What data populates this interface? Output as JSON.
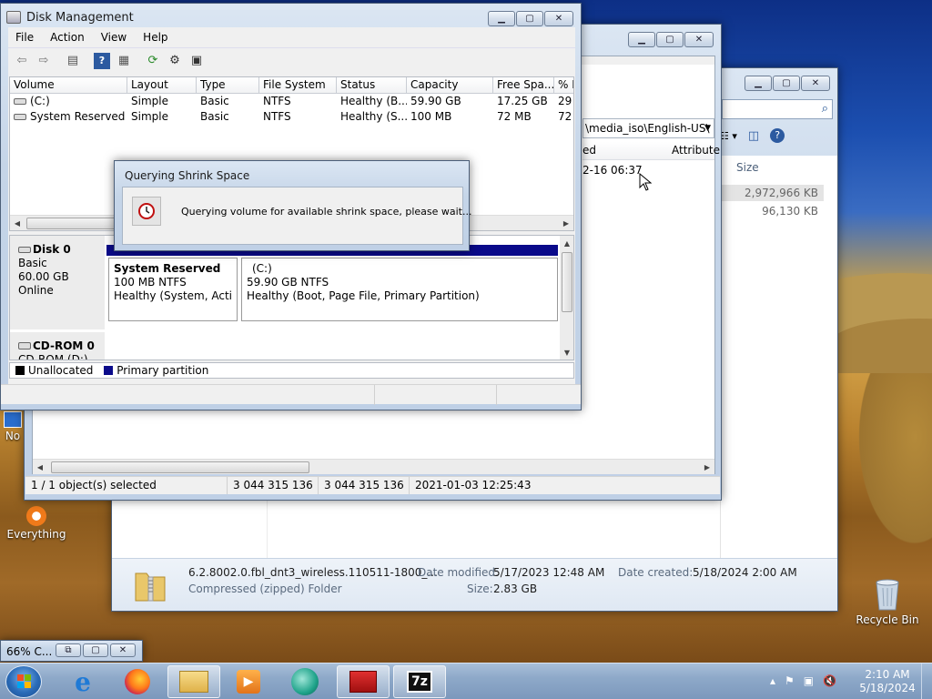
{
  "disk_management": {
    "title": "Disk Management",
    "menu": [
      "File",
      "Action",
      "View",
      "Help"
    ],
    "columns": [
      "Volume",
      "Layout",
      "Type",
      "File System",
      "Status",
      "Capacity",
      "Free Spa...",
      "% F"
    ],
    "rows": [
      {
        "volume": "(C:)",
        "layout": "Simple",
        "type": "Basic",
        "fs": "NTFS",
        "status": "Healthy (B...",
        "capacity": "59.90 GB",
        "free": "17.25 GB",
        "pct": "29"
      },
      {
        "volume": "System Reserved",
        "layout": "Simple",
        "type": "Basic",
        "fs": "NTFS",
        "status": "Healthy (S...",
        "capacity": "100 MB",
        "free": "72 MB",
        "pct": "72"
      }
    ],
    "disk0": {
      "name": "Disk 0",
      "kind": "Basic",
      "size": "60.00 GB",
      "state": "Online"
    },
    "part_reserved": {
      "name": "System Reserved",
      "size": "100 MB NTFS",
      "status": "Healthy (System, Active,"
    },
    "part_c": {
      "name": "(C:)",
      "size": "59.90 GB NTFS",
      "status": "Healthy (Boot, Page File, Primary Partition)"
    },
    "cdrom": {
      "name": "CD-ROM 0",
      "drive": "CD-ROM (D:)"
    },
    "legend": {
      "unallocated": "Unallocated",
      "primary": "Primary partition"
    },
    "colors": {
      "primary": "#0a0a8a",
      "unallocated": "#000000"
    }
  },
  "dialog": {
    "title": "Querying Shrink Space",
    "message": "Querying volume for available shrink space, please wait..."
  },
  "sevenzip_window": {
    "path_fragment": "\\media_iso\\English-US\\",
    "col_modified_fragment": "ed",
    "col_attributes": "Attribute",
    "row_time_fragment": "2-16 06:37",
    "status": [
      "1 / 1 object(s) selected",
      "3 044 315 136",
      "3 044 315 136",
      "2021-01-03 12:25:43"
    ]
  },
  "explorer_window": {
    "col_size": "Size",
    "sizes": [
      "2,972,966 KB",
      "96,130 KB"
    ],
    "details": {
      "name": "6.2.8002.0.fbl_dnt3_wireless.110511-1800_...",
      "type": "Compressed (zipped) Folder",
      "modified_label": "Date modified:",
      "modified": "5/17/2023 12:48 AM",
      "created_label": "Date created:",
      "created": "5/18/2024 2:00 AM",
      "size_label": "Size:",
      "size": "2.83 GB"
    }
  },
  "mini_window": {
    "title": "66% C..."
  },
  "desktop": {
    "icon_everything": "Everything",
    "icon_partial": "No",
    "icon_recycle": "Recycle Bin"
  },
  "taskbar": {
    "time": "2:10 AM",
    "date": "5/18/2024"
  }
}
